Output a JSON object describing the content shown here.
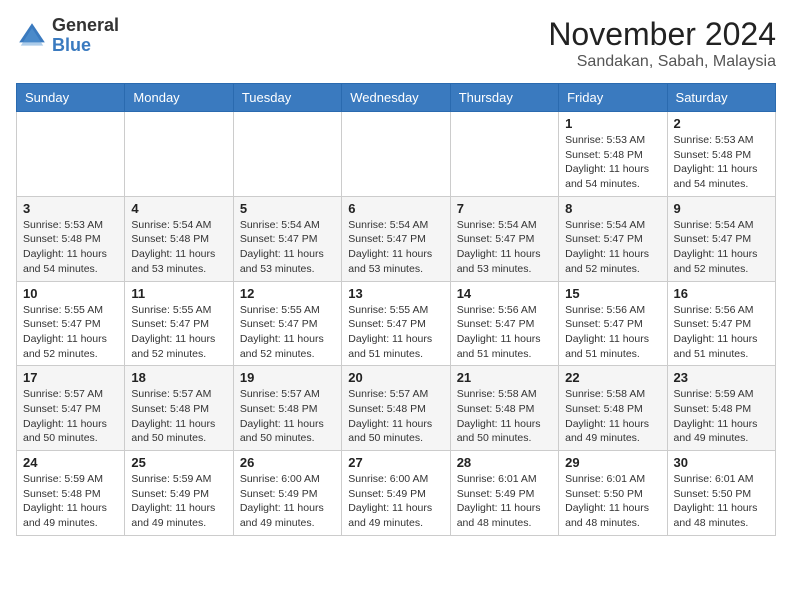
{
  "header": {
    "logo_general": "General",
    "logo_blue": "Blue",
    "month_year": "November 2024",
    "location": "Sandakan, Sabah, Malaysia"
  },
  "calendar": {
    "days_of_week": [
      "Sunday",
      "Monday",
      "Tuesday",
      "Wednesday",
      "Thursday",
      "Friday",
      "Saturday"
    ],
    "weeks": [
      [
        {
          "day": "",
          "info": ""
        },
        {
          "day": "",
          "info": ""
        },
        {
          "day": "",
          "info": ""
        },
        {
          "day": "",
          "info": ""
        },
        {
          "day": "",
          "info": ""
        },
        {
          "day": "1",
          "info": "Sunrise: 5:53 AM\nSunset: 5:48 PM\nDaylight: 11 hours\nand 54 minutes."
        },
        {
          "day": "2",
          "info": "Sunrise: 5:53 AM\nSunset: 5:48 PM\nDaylight: 11 hours\nand 54 minutes."
        }
      ],
      [
        {
          "day": "3",
          "info": "Sunrise: 5:53 AM\nSunset: 5:48 PM\nDaylight: 11 hours\nand 54 minutes."
        },
        {
          "day": "4",
          "info": "Sunrise: 5:54 AM\nSunset: 5:48 PM\nDaylight: 11 hours\nand 53 minutes."
        },
        {
          "day": "5",
          "info": "Sunrise: 5:54 AM\nSunset: 5:47 PM\nDaylight: 11 hours\nand 53 minutes."
        },
        {
          "day": "6",
          "info": "Sunrise: 5:54 AM\nSunset: 5:47 PM\nDaylight: 11 hours\nand 53 minutes."
        },
        {
          "day": "7",
          "info": "Sunrise: 5:54 AM\nSunset: 5:47 PM\nDaylight: 11 hours\nand 53 minutes."
        },
        {
          "day": "8",
          "info": "Sunrise: 5:54 AM\nSunset: 5:47 PM\nDaylight: 11 hours\nand 52 minutes."
        },
        {
          "day": "9",
          "info": "Sunrise: 5:54 AM\nSunset: 5:47 PM\nDaylight: 11 hours\nand 52 minutes."
        }
      ],
      [
        {
          "day": "10",
          "info": "Sunrise: 5:55 AM\nSunset: 5:47 PM\nDaylight: 11 hours\nand 52 minutes."
        },
        {
          "day": "11",
          "info": "Sunrise: 5:55 AM\nSunset: 5:47 PM\nDaylight: 11 hours\nand 52 minutes."
        },
        {
          "day": "12",
          "info": "Sunrise: 5:55 AM\nSunset: 5:47 PM\nDaylight: 11 hours\nand 52 minutes."
        },
        {
          "day": "13",
          "info": "Sunrise: 5:55 AM\nSunset: 5:47 PM\nDaylight: 11 hours\nand 51 minutes."
        },
        {
          "day": "14",
          "info": "Sunrise: 5:56 AM\nSunset: 5:47 PM\nDaylight: 11 hours\nand 51 minutes."
        },
        {
          "day": "15",
          "info": "Sunrise: 5:56 AM\nSunset: 5:47 PM\nDaylight: 11 hours\nand 51 minutes."
        },
        {
          "day": "16",
          "info": "Sunrise: 5:56 AM\nSunset: 5:47 PM\nDaylight: 11 hours\nand 51 minutes."
        }
      ],
      [
        {
          "day": "17",
          "info": "Sunrise: 5:57 AM\nSunset: 5:47 PM\nDaylight: 11 hours\nand 50 minutes."
        },
        {
          "day": "18",
          "info": "Sunrise: 5:57 AM\nSunset: 5:48 PM\nDaylight: 11 hours\nand 50 minutes."
        },
        {
          "day": "19",
          "info": "Sunrise: 5:57 AM\nSunset: 5:48 PM\nDaylight: 11 hours\nand 50 minutes."
        },
        {
          "day": "20",
          "info": "Sunrise: 5:57 AM\nSunset: 5:48 PM\nDaylight: 11 hours\nand 50 minutes."
        },
        {
          "day": "21",
          "info": "Sunrise: 5:58 AM\nSunset: 5:48 PM\nDaylight: 11 hours\nand 50 minutes."
        },
        {
          "day": "22",
          "info": "Sunrise: 5:58 AM\nSunset: 5:48 PM\nDaylight: 11 hours\nand 49 minutes."
        },
        {
          "day": "23",
          "info": "Sunrise: 5:59 AM\nSunset: 5:48 PM\nDaylight: 11 hours\nand 49 minutes."
        }
      ],
      [
        {
          "day": "24",
          "info": "Sunrise: 5:59 AM\nSunset: 5:48 PM\nDaylight: 11 hours\nand 49 minutes."
        },
        {
          "day": "25",
          "info": "Sunrise: 5:59 AM\nSunset: 5:49 PM\nDaylight: 11 hours\nand 49 minutes."
        },
        {
          "day": "26",
          "info": "Sunrise: 6:00 AM\nSunset: 5:49 PM\nDaylight: 11 hours\nand 49 minutes."
        },
        {
          "day": "27",
          "info": "Sunrise: 6:00 AM\nSunset: 5:49 PM\nDaylight: 11 hours\nand 49 minutes."
        },
        {
          "day": "28",
          "info": "Sunrise: 6:01 AM\nSunset: 5:49 PM\nDaylight: 11 hours\nand 48 minutes."
        },
        {
          "day": "29",
          "info": "Sunrise: 6:01 AM\nSunset: 5:50 PM\nDaylight: 11 hours\nand 48 minutes."
        },
        {
          "day": "30",
          "info": "Sunrise: 6:01 AM\nSunset: 5:50 PM\nDaylight: 11 hours\nand 48 minutes."
        }
      ]
    ]
  }
}
